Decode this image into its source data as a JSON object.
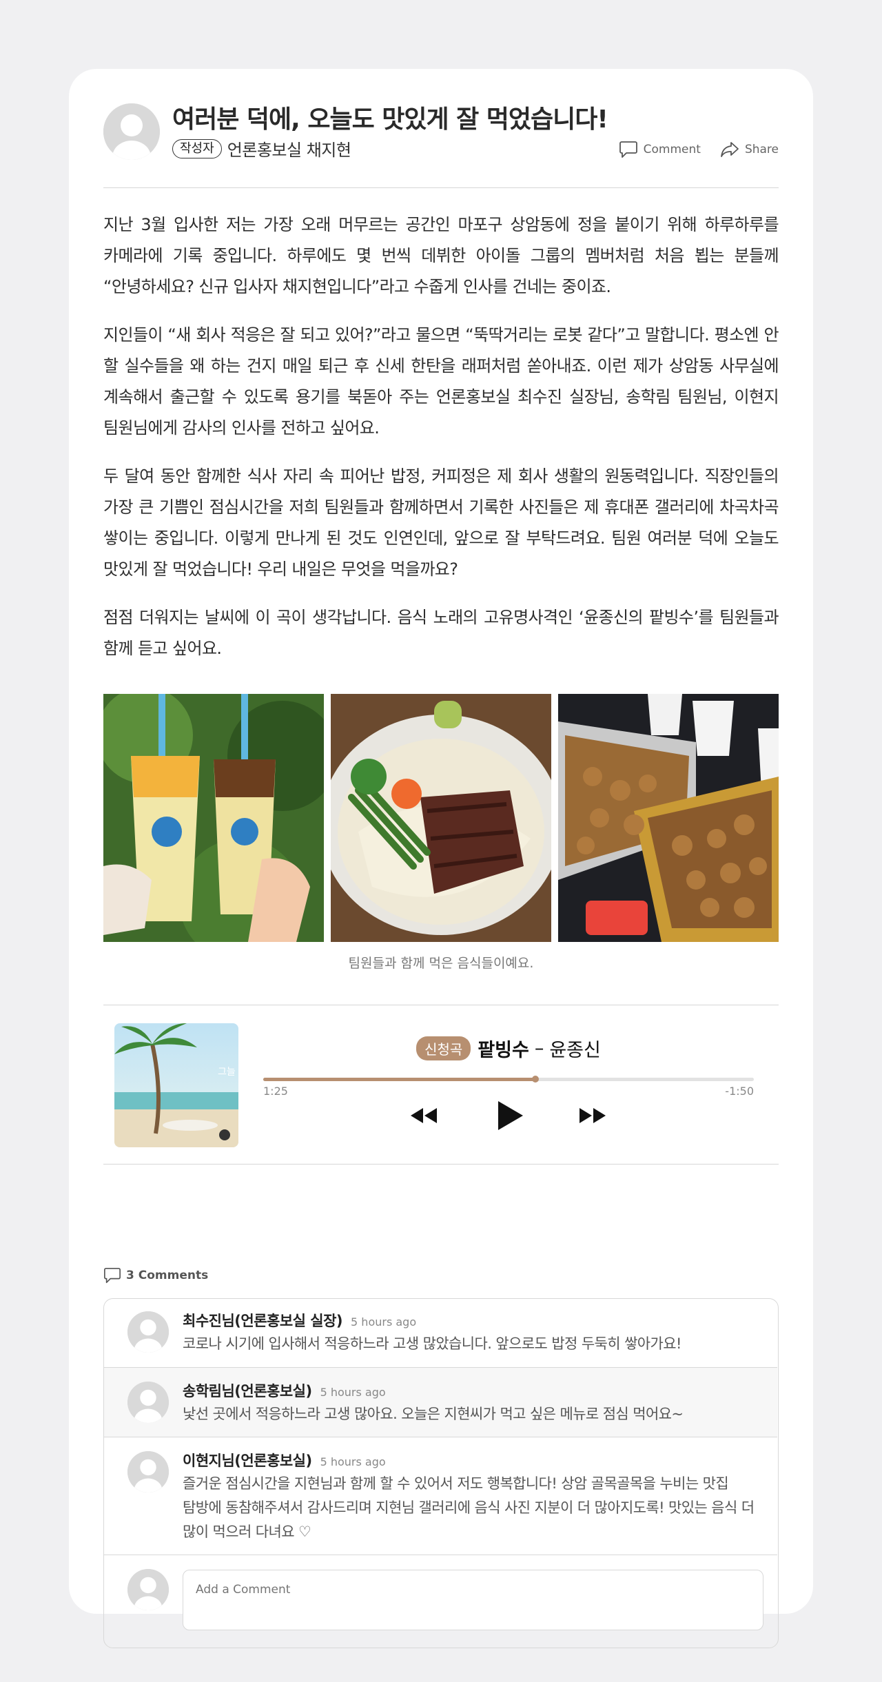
{
  "post": {
    "title": "여러분 덕에, 오늘도 맛있게 잘 먹었습니다!",
    "role_badge": "작성자",
    "author": "언론홍보실 채지현",
    "actions": {
      "comment": "Comment",
      "share": "Share"
    },
    "paragraphs": [
      "지난 3월 입사한 저는 가장 오래 머무르는 공간인 마포구 상암동에 정을 붙이기 위해 하루하루를 카메라에 기록 중입니다. 하루에도 몇 번씩 데뷔한 아이돌 그룹의 멤버처럼 처음 뵙는 분들께 “안녕하세요? 신규 입사자 채지현입니다”라고 수줍게 인사를 건네는 중이죠.",
      "지인들이 “새 회사 적응은 잘 되고 있어?”라고 물으면 “뚝딱거리는 로봇 같다”고 말합니다. 평소엔 안 할 실수들을 왜 하는 건지 매일 퇴근 후 신세 한탄을 래퍼처럼 쏟아내죠. 이런 제가 상암동 사무실에 계속해서 출근할 수 있도록 용기를 북돋아 주는 언론홍보실 최수진 실장님, 송학림 팀원님, 이현지 팀원님에게 감사의 인사를 전하고 싶어요.",
      "두 달여 동안 함께한 식사 자리 속 피어난 밥정, 커피정은 제 회사 생활의 원동력입니다. 직장인들의 가장 큰 기쁨인 점심시간을 저희 팀원들과 함께하면서 기록한 사진들은 제 휴대폰 갤러리에 차곡차곡 쌓이는 중입니다. 이렇게 만나게 된 것도 인연인데, 앞으로 잘 부탁드려요. 팀원 여러분 덕에 오늘도 맛있게 잘 먹었습니다! 우리 내일은 무엇을 먹을까요?",
      "점점 더워지는 날씨에 이 곡이 생각납니다. 음식 노래의 고유명사격인 ‘윤종신의 팥빙수’를 팀원들과 함께 듣고 싶어요."
    ],
    "gallery_caption": "팀원들과 함께 먹은 음식들이예요."
  },
  "player": {
    "badge": "신청곡",
    "song": "팥빙수",
    "separator": "–",
    "artist": "윤종신",
    "elapsed": "1:25",
    "remaining": "-1:50",
    "progress": 0.555,
    "album_text": "그늘"
  },
  "comments": {
    "count_label": "3 Comments",
    "items": [
      {
        "author": "최수진님(언론홍보실 실장)",
        "time": "5 hours ago",
        "text": "코로나 시기에 입사해서 적응하느라 고생 많았습니다. 앞으로도 밥정 두둑히 쌓아가요!"
      },
      {
        "author": "송학림님(언론홍보실)",
        "time": "5 hours ago",
        "text": "낯선 곳에서 적응하느라 고생 많아요. 오늘은 지현씨가 먹고 싶은 메뉴로 점심 먹어요~"
      },
      {
        "author": "이현지님(언론홍보실)",
        "time": "5 hours ago",
        "text": "즐거운 점심시간을 지현님과 함께 할 수 있어서 저도 행복합니다! 상암 골목골목을 누비는 맛집 탐방에 동참해주셔서 감사드리며 지현님 갤러리에 음식 사진 지분이 더 많아지도록! 맛있는 음식 더 많이 먹으러 다녀요 ♡"
      }
    ],
    "add_placeholder": "Add a Comment"
  },
  "colors": {
    "accent": "#b78f70",
    "background": "#f0f0f2",
    "card": "#ffffff"
  },
  "icons": [
    "user-avatar-icon",
    "comment-icon",
    "share-icon",
    "rewind-icon",
    "play-icon",
    "fast-forward-icon"
  ]
}
